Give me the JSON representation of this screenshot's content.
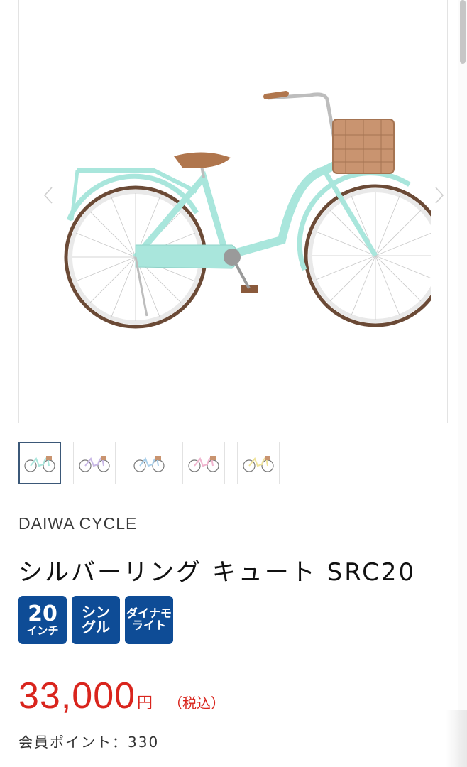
{
  "product": {
    "brand": "DAIWA CYCLE",
    "title": "シルバーリング キュート SRC20",
    "price": "33,000",
    "currency": "円",
    "tax_note": "（税込）",
    "points_label": "会員ポイント：330"
  },
  "badges": [
    {
      "line1": "20",
      "line2": "インチ"
    },
    {
      "line1": "シン",
      "line2": "グル"
    },
    {
      "line1": "ダイナモ",
      "line2": "ライト"
    }
  ],
  "gallery": {
    "main_color": "#a9e6dc",
    "variants": [
      {
        "name": "mint",
        "color": "#a9e6dc",
        "selected": true
      },
      {
        "name": "lavender",
        "color": "#c9b8e6",
        "selected": false
      },
      {
        "name": "light-blue",
        "color": "#a9cfea",
        "selected": false
      },
      {
        "name": "pink",
        "color": "#f1b5cf",
        "selected": false
      },
      {
        "name": "yellow",
        "color": "#efe39a",
        "selected": false
      }
    ]
  },
  "colors": {
    "price": "#d9251d",
    "badge": "#0e4c96",
    "thumb_active_border": "#3b5878"
  },
  "icons": [
    "chevron-left-icon",
    "chevron-right-icon"
  ]
}
